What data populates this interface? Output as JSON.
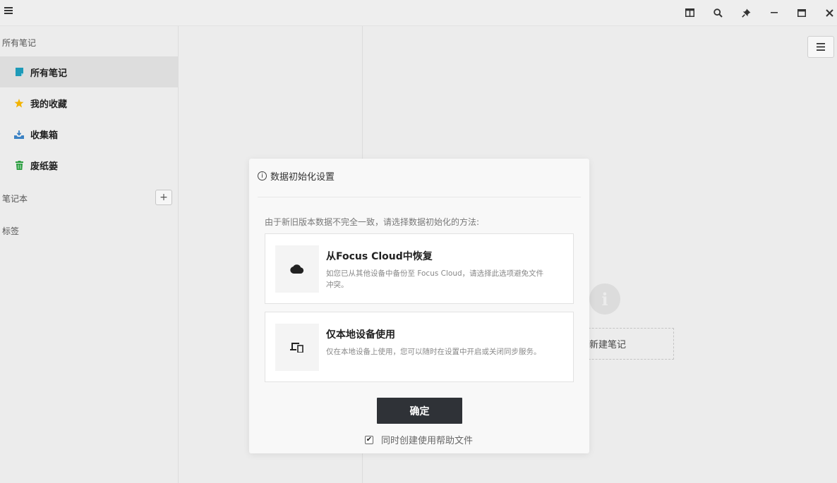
{
  "titlebar": {
    "menu_icon": "hamburger-icon",
    "buttons": [
      "layout-icon",
      "search-icon",
      "pin-icon",
      "minimize-icon",
      "maximize-icon",
      "close-icon"
    ]
  },
  "sidebar": {
    "all_notes_section": "所有笔记",
    "items": [
      {
        "label": "所有笔记",
        "icon": "note-icon",
        "color": "#1e9ab8",
        "active": true
      },
      {
        "label": "我的收藏",
        "icon": "star-icon",
        "color": "#f2b300"
      },
      {
        "label": "收集箱",
        "icon": "inbox-icon",
        "color": "#3b82c4"
      },
      {
        "label": "废纸篓",
        "icon": "trash-icon",
        "color": "#2a9d3f"
      }
    ],
    "notebooks_label": "笔记本",
    "add_label": "+",
    "tags_label": "标签"
  },
  "editor": {
    "menu_icon": "hamburger-icon",
    "info_glyph": "i",
    "new_note_label": "新建笔记"
  },
  "dialog": {
    "info_glyph": "i",
    "title": "数据初始化设置",
    "description": "由于新旧版本数据不完全一致，请选择数据初始化的方法:",
    "options": [
      {
        "icon": "cloud-icon",
        "title": "从Focus Cloud中恢复",
        "description": "如您已从其他设备中备份至 Focus Cloud，请选择此选项避免文件冲突。"
      },
      {
        "icon": "devices-icon",
        "title": "仅本地设备使用",
        "description": "仅在本地设备上使用，您可以随时在设置中开启或关闭同步服务。"
      }
    ],
    "confirm_label": "确定",
    "help_checkbox_label": "同时创建使用帮助文件",
    "help_checked": true
  }
}
